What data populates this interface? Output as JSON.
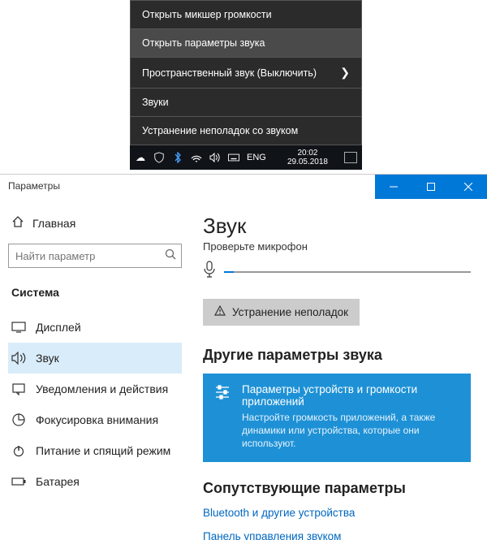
{
  "context_menu": {
    "items": [
      {
        "label": "Открыть микшер громкости"
      },
      {
        "label": "Открыть параметры звука",
        "selected": true
      },
      {
        "label": "Пространственный звук (Выключить)",
        "has_submenu": true
      },
      {
        "label": "Звуки"
      },
      {
        "label": "Устранение неполадок со звуком"
      }
    ]
  },
  "taskbar": {
    "lang": "ENG",
    "time": "20:02",
    "date": "29.05.2018"
  },
  "settings": {
    "window_title": "Параметры",
    "home_label": "Главная",
    "search_placeholder": "Найти параметр",
    "category": "Система",
    "nav": [
      {
        "label": "Дисплей",
        "icon": "display"
      },
      {
        "label": "Звук",
        "icon": "sound",
        "active": true
      },
      {
        "label": "Уведомления и действия",
        "icon": "notify"
      },
      {
        "label": "Фокусировка внимания",
        "icon": "focus"
      },
      {
        "label": "Питание и спящий режим",
        "icon": "power"
      },
      {
        "label": "Батарея",
        "icon": "battery"
      }
    ],
    "main": {
      "heading": "Звук",
      "mic_label": "Проверьте микрофон",
      "mic_level_percent": 4,
      "troubleshoot_label": "Устранение неполадок",
      "other_heading": "Другие параметры звука",
      "tile_title": "Параметры устройств и громкости приложений",
      "tile_desc": "Настройте громкость приложений, а также динамики или устройства, которые они используют.",
      "related_heading": "Сопутствующие параметры",
      "link_bluetooth": "Bluetooth и другие устройства",
      "link_panel": "Панель управления звуком"
    }
  }
}
